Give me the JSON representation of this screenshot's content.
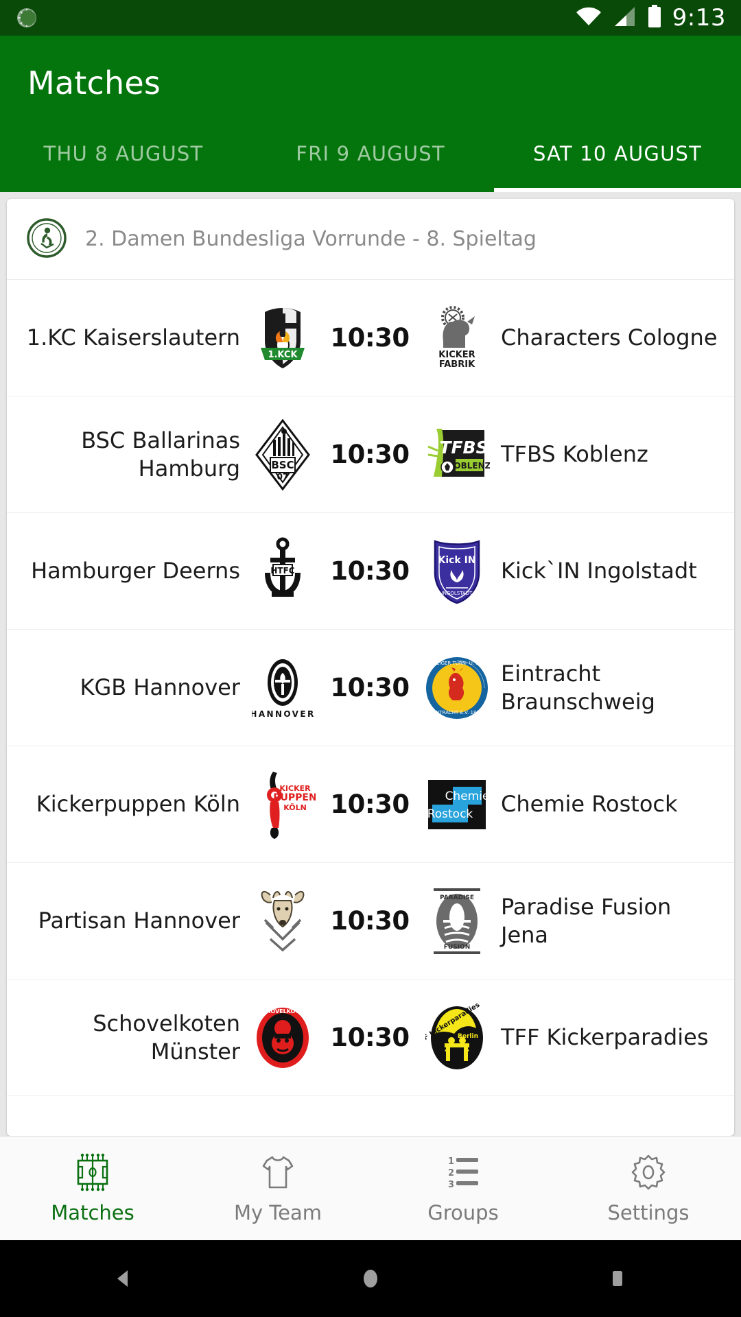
{
  "status_bar": {
    "clock": "9:13",
    "icons": [
      "app-notification-icon",
      "wifi-icon",
      "cellular-signal-icon",
      "battery-icon"
    ]
  },
  "app_bar": {
    "title": "Matches"
  },
  "tabs": [
    {
      "label": "THU 8 AUGUST",
      "active": false
    },
    {
      "label": "FRI 9 AUGUST",
      "active": false
    },
    {
      "label": "SAT 10 AUGUST",
      "active": true
    }
  ],
  "league": {
    "logo": "league-crest-icon",
    "name": "2. Damen Bundesliga Vorrunde - 8. Spieltag"
  },
  "matches": [
    {
      "home": "1.KC Kaiserslautern",
      "home_crest": "kaiserslautern-crest-icon",
      "kickoff": "10:30",
      "away": "Characters Cologne",
      "away_crest": "kickerfabrik-crest-icon"
    },
    {
      "home": "BSC Ballarinas Hamburg",
      "home_crest": "bsc-hamburg-crest-icon",
      "kickoff": "10:30",
      "away": "TFBS Koblenz",
      "away_crest": "tfbs-koblenz-crest-icon"
    },
    {
      "home": "Hamburger Deerns",
      "home_crest": "htfc-anchor-crest-icon",
      "kickoff": "10:30",
      "away": "Kick`IN Ingolstadt",
      "away_crest": "kickin-ingolstadt-crest-icon"
    },
    {
      "home": "KGB Hannover",
      "home_crest": "kgb-hannover-crest-icon",
      "kickoff": "10:30",
      "away": "Eintracht Braunschweig",
      "away_crest": "eintracht-braunschweig-crest-icon"
    },
    {
      "home": "Kickerpuppen Köln",
      "home_crest": "kickerpuppen-koeln-crest-icon",
      "kickoff": "10:30",
      "away": "Chemie Rostock",
      "away_crest": "chemie-rostock-crest-icon"
    },
    {
      "home": "Partisan Hannover",
      "home_crest": "partisan-hannover-crest-icon",
      "kickoff": "10:30",
      "away": "Paradise Fusion Jena",
      "away_crest": "paradise-fusion-jena-crest-icon"
    },
    {
      "home": "Schovelkoten Münster",
      "home_crest": "schovelkoten-muenster-crest-icon",
      "kickoff": "10:30",
      "away": "TFF Kickerparadies",
      "away_crest": "tff-kickerparadies-crest-icon"
    }
  ],
  "bottom_nav": [
    {
      "label": "Matches",
      "icon": "pitch-icon",
      "active": true
    },
    {
      "label": "My Team",
      "icon": "shirt-icon",
      "active": false
    },
    {
      "label": "Groups",
      "icon": "ranking-list-icon",
      "active": false
    },
    {
      "label": "Settings",
      "icon": "gear-icon",
      "active": false
    }
  ],
  "system_nav": [
    {
      "icon": "back-icon"
    },
    {
      "icon": "home-icon"
    },
    {
      "icon": "recents-icon"
    }
  ],
  "colors": {
    "status_bar": "#0a4a08",
    "app_bar": "#04750c",
    "accent": "#0a7012",
    "content_bg": "#e7e7e7",
    "card": "#ffffff"
  }
}
